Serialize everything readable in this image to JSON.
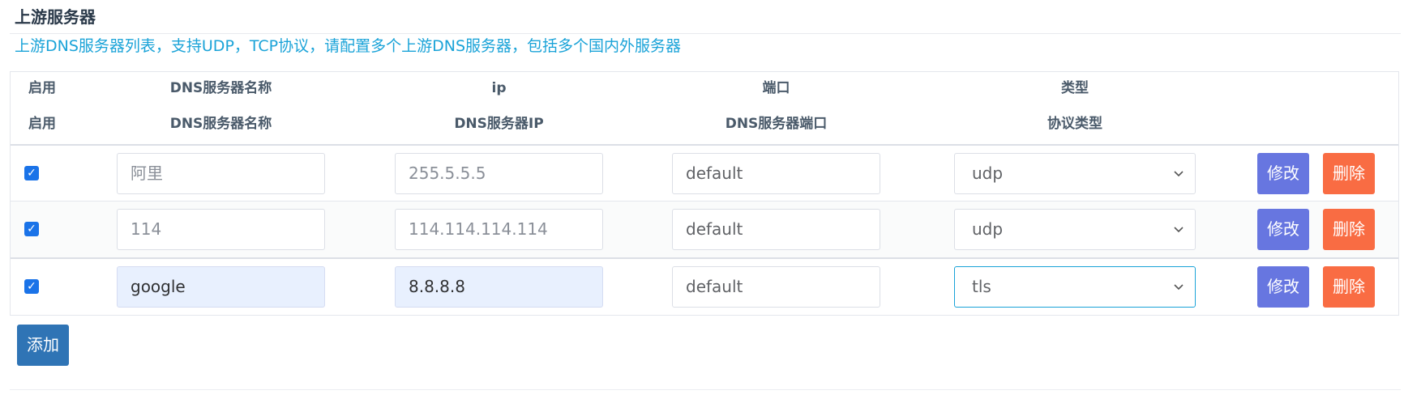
{
  "section": {
    "title": "上游服务器",
    "description": "上游DNS服务器列表，支持UDP，TCP协议，请配置多个上游DNS服务器，包括多个国内外服务器"
  },
  "table": {
    "header_row1": {
      "enabled": "启用",
      "name": "DNS服务器名称",
      "ip": "ip",
      "port": "端口",
      "type": "类型"
    },
    "header_row2": {
      "enabled": "启用",
      "name": "DNS服务器名称",
      "ip": "DNS服务器IP",
      "port": "DNS服务器端口",
      "type": "协议类型"
    },
    "rows": [
      {
        "enabled": true,
        "name": "阿里",
        "name_is_placeholder": true,
        "ip": "255.5.5.5",
        "ip_is_placeholder": true,
        "port": "default",
        "type": "udp",
        "edit_label": "修改",
        "delete_label": "删除"
      },
      {
        "enabled": true,
        "name": "114",
        "name_is_placeholder": true,
        "ip": "114.114.114.114",
        "ip_is_placeholder": true,
        "port": "default",
        "type": "udp",
        "edit_label": "修改",
        "delete_label": "删除"
      },
      {
        "enabled": true,
        "name": "google",
        "name_is_placeholder": false,
        "ip": "8.8.8.8",
        "ip_is_placeholder": false,
        "port": "default",
        "type": "tls",
        "type_focused": true,
        "edit_label": "修改",
        "delete_label": "删除"
      }
    ]
  },
  "add_button_label": "添加",
  "colors": {
    "accent_text": "#1aa3d8",
    "edit_button": "#6776e0",
    "delete_button": "#f96c43",
    "add_button": "#2f74b5",
    "checkbox": "#1a73e8"
  },
  "icons": {
    "select_arrow": "chevron-down-icon",
    "checkbox_mark": "check-icon"
  }
}
